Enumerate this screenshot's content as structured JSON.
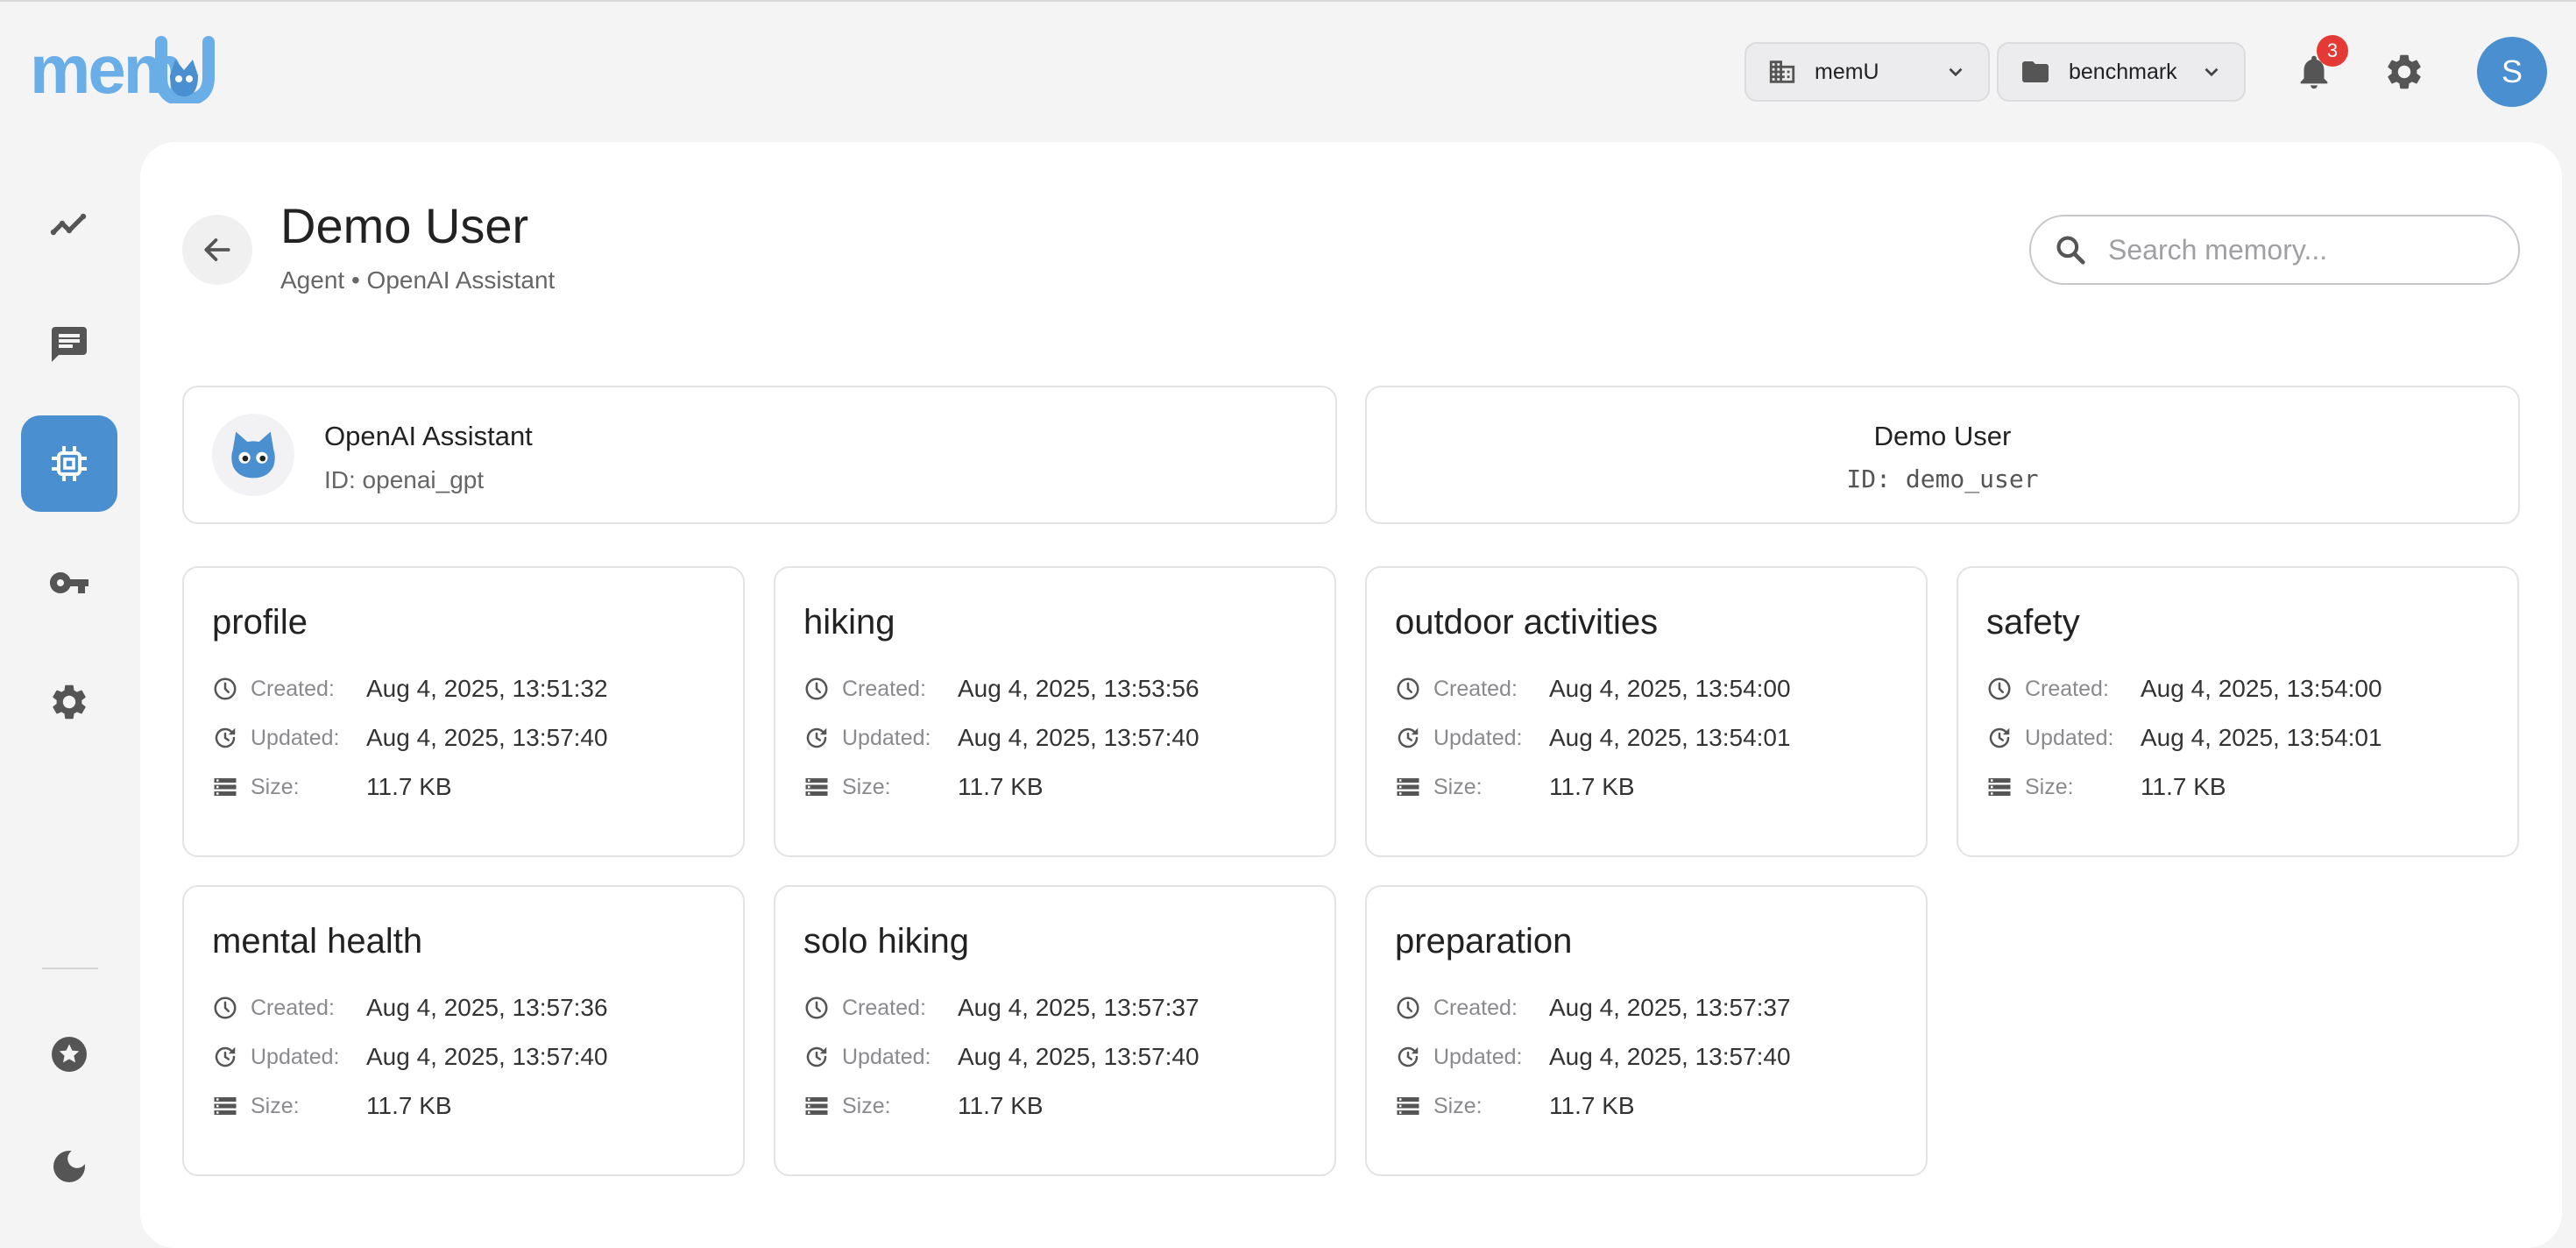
{
  "header": {
    "org_selector": {
      "label": "memU",
      "icon": "building-icon"
    },
    "project_selector": {
      "label": "benchmark",
      "icon": "folder-icon"
    },
    "notifications": {
      "count": "3",
      "icon": "bell-icon"
    },
    "settings_icon": "gear-icon",
    "avatar_initial": "S"
  },
  "sidebar": {
    "items": [
      {
        "name": "analytics",
        "icon": "trend-line-icon"
      },
      {
        "name": "conversations",
        "icon": "chat-icon"
      },
      {
        "name": "memory",
        "icon": "chip-icon",
        "active": true
      },
      {
        "name": "api-keys",
        "icon": "key-icon"
      },
      {
        "name": "settings",
        "icon": "gear-icon"
      },
      {
        "name": "favorites",
        "icon": "star-icon"
      },
      {
        "name": "theme",
        "icon": "moon-icon"
      }
    ]
  },
  "page": {
    "title": "Demo User",
    "subtitle": "Agent • OpenAI Assistant",
    "search_placeholder": "Search memory..."
  },
  "agent_card": {
    "name": "OpenAI Assistant",
    "id": "ID: openai_gpt"
  },
  "user_card": {
    "name": "Demo User",
    "id": "ID: demo_user"
  },
  "labels": {
    "created": "Created:",
    "updated": "Updated:",
    "size": "Size:"
  },
  "memories": [
    {
      "title": "profile",
      "created": "Aug 4, 2025, 13:51:32",
      "updated": "Aug 4, 2025, 13:57:40",
      "size": "11.7 KB"
    },
    {
      "title": "hiking",
      "created": "Aug 4, 2025, 13:53:56",
      "updated": "Aug 4, 2025, 13:57:40",
      "size": "11.7 KB"
    },
    {
      "title": "outdoor activities",
      "created": "Aug 4, 2025, 13:54:00",
      "updated": "Aug 4, 2025, 13:54:01",
      "size": "11.7 KB"
    },
    {
      "title": "safety",
      "created": "Aug 4, 2025, 13:54:00",
      "updated": "Aug 4, 2025, 13:54:01",
      "size": "11.7 KB"
    },
    {
      "title": "mental health",
      "created": "Aug 4, 2025, 13:57:36",
      "updated": "Aug 4, 2025, 13:57:40",
      "size": "11.7 KB"
    },
    {
      "title": "solo hiking",
      "created": "Aug 4, 2025, 13:57:37",
      "updated": "Aug 4, 2025, 13:57:40",
      "size": "11.7 KB"
    },
    {
      "title": "preparation",
      "created": "Aug 4, 2025, 13:57:37",
      "updated": "Aug 4, 2025, 13:57:40",
      "size": "11.7 KB"
    }
  ],
  "colors": {
    "accent": "#4a8fcf",
    "badge": "#e53935",
    "background": "#f4f4f5"
  }
}
